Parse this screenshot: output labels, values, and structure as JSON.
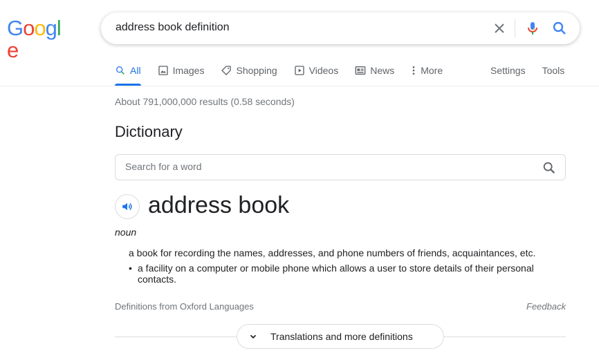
{
  "logo": {
    "letters": [
      "G",
      "o",
      "o",
      "g",
      "l",
      "e"
    ],
    "colors": [
      "#4285f4",
      "#ea4335",
      "#fbbc05",
      "#4285f4",
      "#34a853",
      "#ea4335"
    ]
  },
  "search": {
    "query": "address book definition",
    "clear_icon": "close-icon",
    "mic_icon": "mic-icon",
    "search_icon": "search-icon"
  },
  "tabs": [
    {
      "label": "All",
      "icon": "search-icon",
      "active": true
    },
    {
      "label": "Images",
      "icon": "image-icon"
    },
    {
      "label": "Shopping",
      "icon": "tag-icon"
    },
    {
      "label": "Videos",
      "icon": "play-icon"
    },
    {
      "label": "News",
      "icon": "newspaper-icon"
    },
    {
      "label": "More",
      "icon": "kebab-icon"
    }
  ],
  "tools": {
    "settings": "Settings",
    "tools": "Tools"
  },
  "stats": "About 791,000,000 results (0.58 seconds)",
  "dictionary": {
    "title": "Dictionary",
    "search_placeholder": "Search for a word",
    "word": "address book",
    "part_of_speech": "noun",
    "definitions": [
      "a book for recording the names, addresses, and phone numbers of friends, acquaintances, etc.",
      "a facility on a computer or mobile phone which allows a user to store details of their personal contacts."
    ],
    "source": "Definitions from Oxford Languages",
    "feedback": "Feedback",
    "more_button": "Translations and more definitions"
  },
  "colors": {
    "accent": "#1a73e8",
    "muted": "#70757a",
    "text": "#202124"
  }
}
